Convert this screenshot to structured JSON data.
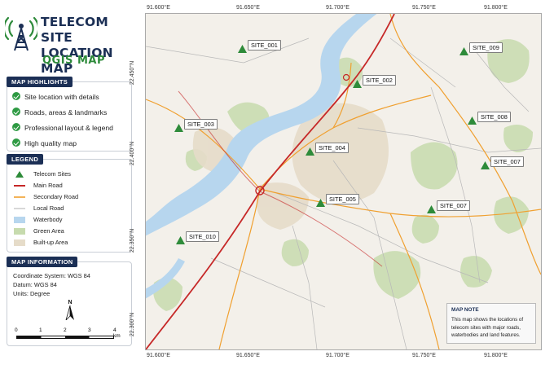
{
  "app": {
    "title_line1": "TELECOM SITE",
    "title_line2": "LOCATION MAP",
    "subtitle": "QGIS MAP"
  },
  "highlights": {
    "header": "MAP HIGHLIGHTS",
    "items": [
      "Site location with details",
      "Roads, areas & landmarks",
      "Professional layout & legend",
      "High quality map"
    ]
  },
  "legend": {
    "header": "LEGEND",
    "items": [
      {
        "label": "Telecom Sites",
        "kind": "triangle",
        "color": "#2e8b3a"
      },
      {
        "label": "Main Road",
        "kind": "line",
        "color": "#c62828"
      },
      {
        "label": "Secondary Road",
        "kind": "line",
        "color": "#f0a030"
      },
      {
        "label": "Local Road",
        "kind": "thin-line",
        "color": "#b0b0b0"
      },
      {
        "label": "Waterbody",
        "kind": "fill",
        "color": "#b7d6ee"
      },
      {
        "label": "Green Area",
        "kind": "fill",
        "color": "#c7dbae"
      },
      {
        "label": "Built-up Area",
        "kind": "fill",
        "color": "#e6dcc9"
      }
    ]
  },
  "map_info": {
    "header": "MAP INFORMATION",
    "coordinate_system": "Coordinate System: WGS 84",
    "datum": "Datum: WGS 84",
    "units": "Units: Degree",
    "north": "N",
    "scale_ticks": [
      "0",
      "1",
      "2",
      "3",
      "4 km"
    ]
  },
  "map": {
    "lon_labels": [
      "91.600°E",
      "91.650°E",
      "91.700°E",
      "91.750°E",
      "91.800°E"
    ],
    "lat_labels": [
      "22.450°N",
      "22.400°N",
      "22.350°N",
      "22.300°N"
    ],
    "sites": [
      {
        "name": "SITE_001"
      },
      {
        "name": "SITE_002"
      },
      {
        "name": "SITE_003"
      },
      {
        "name": "SITE_004"
      },
      {
        "name": "SITE_005"
      },
      {
        "name": "SITE_007"
      },
      {
        "name": "SITE_007"
      },
      {
        "name": "SITE_008"
      },
      {
        "name": "SITE_009"
      },
      {
        "name": "SITE_010"
      }
    ],
    "note_title": "MAP NOTE",
    "note_lines": [
      "This map shows the locations of",
      "telecom sites with major roads,",
      "waterbodies and land features."
    ]
  },
  "colors": {
    "navy": "#1b2f55",
    "brand_green": "#2d8a3a",
    "site_green": "#2e8b3a",
    "main_road": "#c62828",
    "secondary_road": "#f0a030",
    "water": "#b7d6ee",
    "green_area": "#c7dbae",
    "builtup": "#e6dcc9"
  }
}
